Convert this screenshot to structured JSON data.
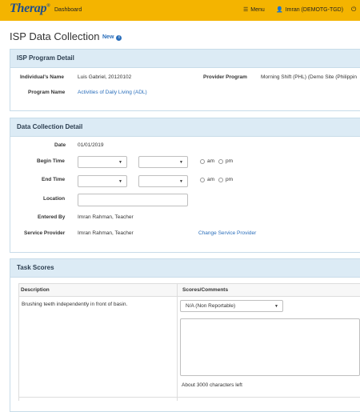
{
  "topbar": {
    "logo": "Therap",
    "logo_mark": "®",
    "nav_dashboard": "Dashboard",
    "menu_label": "Menu",
    "user_label": "Imran (DEMOTG-TGD)"
  },
  "page": {
    "title": "ISP Data Collection",
    "new_label": "New",
    "info_glyph": "i"
  },
  "isp_program_detail": {
    "header": "ISP Program Detail",
    "individual_name_label": "Individual's Name",
    "individual_name": "Luis Gabriel, 20120102",
    "provider_program_label": "Provider Program",
    "provider_program": "Morning Shift (PHL) (Demo Site (Philippin",
    "program_name_label": "Program Name",
    "program_name": "Activities of Daily Living (ADL)"
  },
  "data_collection_detail": {
    "header": "Data Collection Detail",
    "date_label": "Date",
    "date": "01/01/2019",
    "begin_time_label": "Begin Time",
    "end_time_label": "End Time",
    "am_label": "am",
    "pm_label": "pm",
    "location_label": "Location",
    "location_value": "",
    "entered_by_label": "Entered By",
    "entered_by": "Imran Rahman, Teacher",
    "service_provider_label": "Service Provider",
    "service_provider": "Imran Rahman, Teacher",
    "change_service_provider": "Change Service Provider"
  },
  "task_scores": {
    "header": "Task Scores",
    "col_description": "Description",
    "col_scores": "Scores/Comments",
    "rows": [
      {
        "description": "Brushing teeth independently in front of basin.",
        "score": "N/A (Non Reportable)",
        "comment": "",
        "chars_left": "About 3000 characters left"
      }
    ]
  },
  "colors": {
    "topbar": "#f4b400",
    "panel_header": "#dcebf5",
    "link": "#2a6ebb"
  }
}
